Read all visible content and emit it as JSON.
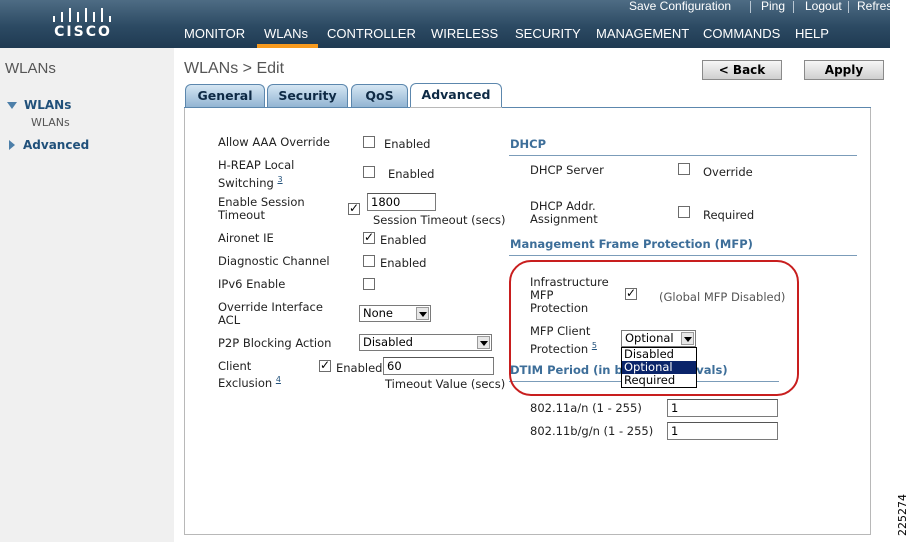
{
  "header": {
    "logo": "CISCO",
    "top_links": [
      "Save Configuration",
      "Ping",
      "Logout",
      "Refresh"
    ],
    "nav": [
      "MONITOR",
      "WLANs",
      "CONTROLLER",
      "WIRELESS",
      "SECURITY",
      "MANAGEMENT",
      "COMMANDS",
      "HELP"
    ],
    "active_nav": "WLANs",
    "accent_color": "#f79a1e"
  },
  "sidebar": {
    "title": "WLANs",
    "items": [
      {
        "label": "WLANs",
        "sub": "WLANs",
        "expanded": true
      },
      {
        "label": "Advanced",
        "expanded": false
      }
    ]
  },
  "page": {
    "title": "WLANs > Edit",
    "back_button": "< Back",
    "apply_button": "Apply",
    "tabs": [
      "General",
      "Security",
      "QoS",
      "Advanced"
    ],
    "active_tab": "Advanced"
  },
  "left": {
    "allow_aaa": {
      "label": "Allow AAA Override",
      "checked": false,
      "text": "Enabled"
    },
    "hreap": {
      "label1": "H-REAP Local",
      "label2": "Switching",
      "footnote": "3",
      "checked": false,
      "text": "Enabled"
    },
    "session": {
      "label1": "Enable Session",
      "label2": "Timeout",
      "checked": true,
      "value": "1800",
      "caption": "Session Timeout (secs)"
    },
    "aironet": {
      "label": "Aironet IE",
      "checked": true,
      "text": "Enabled"
    },
    "diag": {
      "label": "Diagnostic Channel",
      "checked": false,
      "text": "Enabled"
    },
    "ipv6": {
      "label": "IPv6 Enable",
      "checked": false
    },
    "acl": {
      "label1": "Override Interface",
      "label2": "ACL",
      "value": "None"
    },
    "p2p": {
      "label": "P2P Blocking Action",
      "value": "Disabled"
    },
    "client_excl": {
      "label1": "Client",
      "label2": "Exclusion",
      "footnote": "4",
      "checked": true,
      "text": "Enabled",
      "value": "60",
      "caption": "Timeout Value (secs)"
    }
  },
  "right": {
    "dhcp_title": "DHCP",
    "dhcp_server": {
      "label": "DHCP Server",
      "checked": false,
      "text": "Override"
    },
    "dhcp_addr": {
      "label1": "DHCP Addr.",
      "label2": "Assignment",
      "checked": false,
      "text": "Required"
    },
    "mfp_title": "Management Frame Protection (MFP)",
    "infra_mfp": {
      "label1": "Infrastructure",
      "label2": "MFP",
      "label3": "Protection",
      "checked": true,
      "note": "(Global MFP Disabled)"
    },
    "mfp_client": {
      "label1": "MFP Client",
      "label2": "Protection",
      "footnote": "5",
      "value": "Optional",
      "options": [
        "Disabled",
        "Optional",
        "Required"
      ],
      "highlighted": "Optional"
    },
    "dtim_title": "DTIM Period (in beacon intervals)",
    "dtim_a": {
      "label": "802.11a/n (1 - 255)",
      "value": "1"
    },
    "dtim_b": {
      "label": "802.11b/g/n (1 - 255)",
      "value": "1"
    }
  },
  "figure_id": "225274"
}
